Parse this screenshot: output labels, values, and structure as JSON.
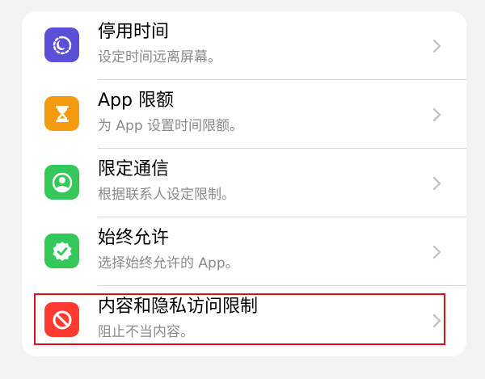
{
  "settings_list": {
    "items": [
      {
        "id": "downtime",
        "title": "停用时间",
        "subtitle": "设定时间远离屏幕。",
        "icon": "moon-clock-icon",
        "icon_color": "#5b4fd6"
      },
      {
        "id": "app-limits",
        "title": "App 限额",
        "subtitle": "为 App 设置时间限额。",
        "icon": "hourglass-icon",
        "icon_color": "#f59a0c"
      },
      {
        "id": "communication-limits",
        "title": "限定通信",
        "subtitle": "根据联系人设定限制。",
        "icon": "person-circle-icon",
        "icon_color": "#34c759"
      },
      {
        "id": "always-allowed",
        "title": "始终允许",
        "subtitle": "选择始终允许的 App。",
        "icon": "checkmark-seal-icon",
        "icon_color": "#34c759"
      },
      {
        "id": "content-privacy",
        "title": "内容和隐私访问限制",
        "subtitle": "阻止不当内容。",
        "icon": "no-entry-icon",
        "icon_color": "#ff3b30"
      }
    ]
  },
  "highlight_color": "#d8121a"
}
